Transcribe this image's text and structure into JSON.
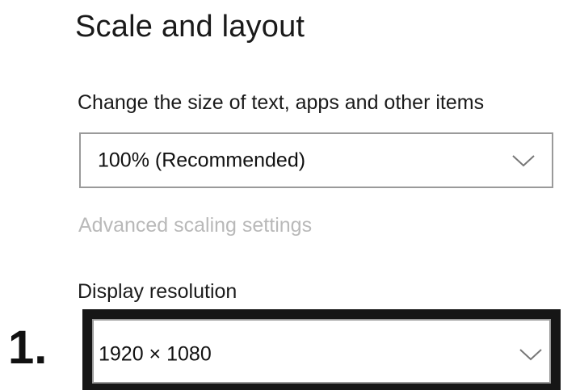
{
  "section": {
    "title": "Scale and layout"
  },
  "scale": {
    "label": "Change the size of text, apps and other items",
    "selected_value": "100% (Recommended)",
    "dropdown_icon": "chevron-down-icon"
  },
  "advanced_link": {
    "label": "Advanced scaling settings",
    "color": "#b9b9b9"
  },
  "resolution": {
    "label": "Display resolution",
    "selected_value": "1920 × 1080",
    "dropdown_icon": "chevron-down-icon"
  },
  "annotation": {
    "step_label": "1.",
    "frame_color": "#161616"
  }
}
